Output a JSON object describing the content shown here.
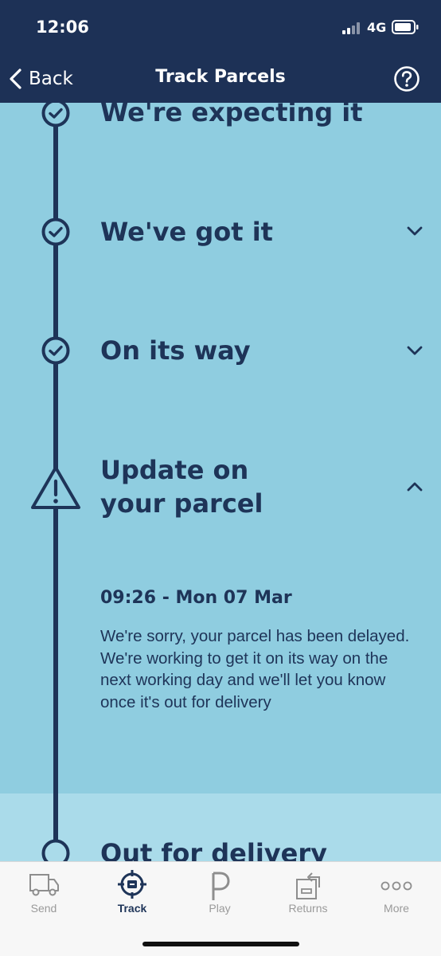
{
  "status_bar": {
    "time": "12:06",
    "network": "4G"
  },
  "nav": {
    "back_label": "Back",
    "title": "Track Parcels"
  },
  "steps": [
    {
      "title": "We're expecting it"
    },
    {
      "title": "We've got it"
    },
    {
      "title": "On its way"
    },
    {
      "title_line1": "Update on",
      "title_line2": "your parcel"
    },
    {
      "title": "Out for delivery"
    }
  ],
  "update": {
    "time": "09:26 - Mon 07 Mar",
    "message": "We're sorry, your parcel has been delayed. We're working to get it on its way on the next working day and we'll let you know once it's out for delivery"
  },
  "tabs": [
    {
      "label": "Send"
    },
    {
      "label": "Track"
    },
    {
      "label": "Play"
    },
    {
      "label": "Returns"
    },
    {
      "label": "More"
    }
  ],
  "colors": {
    "navy": "#1d3156",
    "light_blue": "#8fcde0",
    "pale_blue": "#aadbea"
  }
}
